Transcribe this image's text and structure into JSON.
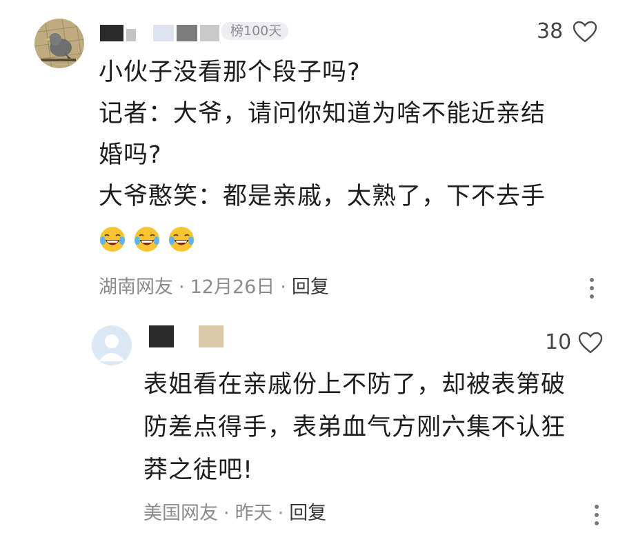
{
  "comment": {
    "badge": "榜100天",
    "likes": "38",
    "lines": [
      "小伙子没看那个段子吗?",
      "记者：大爷，请问你知道为啥不能近亲结",
      "婚吗?",
      "大爷憨笑：都是亲戚，太熟了，下不去手"
    ],
    "emojis": [
      "laughing-tears-emoji",
      "laughing-tears-emoji",
      "laughing-tears-emoji"
    ],
    "location": "湖南网友",
    "date": "12月26日",
    "reply_label": "回复"
  },
  "reply": {
    "likes": "10",
    "lines": [
      "表姐看在亲戚份上不防了，却被表第破",
      "防差点得手，表弟血气方刚六集不认狂",
      "莽之徒吧!"
    ],
    "location": "美国网友",
    "date": "昨天",
    "reply_label": "回复"
  },
  "colors": {
    "text": "#1d1d1d",
    "meta": "#8b8b8b",
    "badge_bg": "#eeeef2",
    "emoji_face": "#f7c531"
  }
}
